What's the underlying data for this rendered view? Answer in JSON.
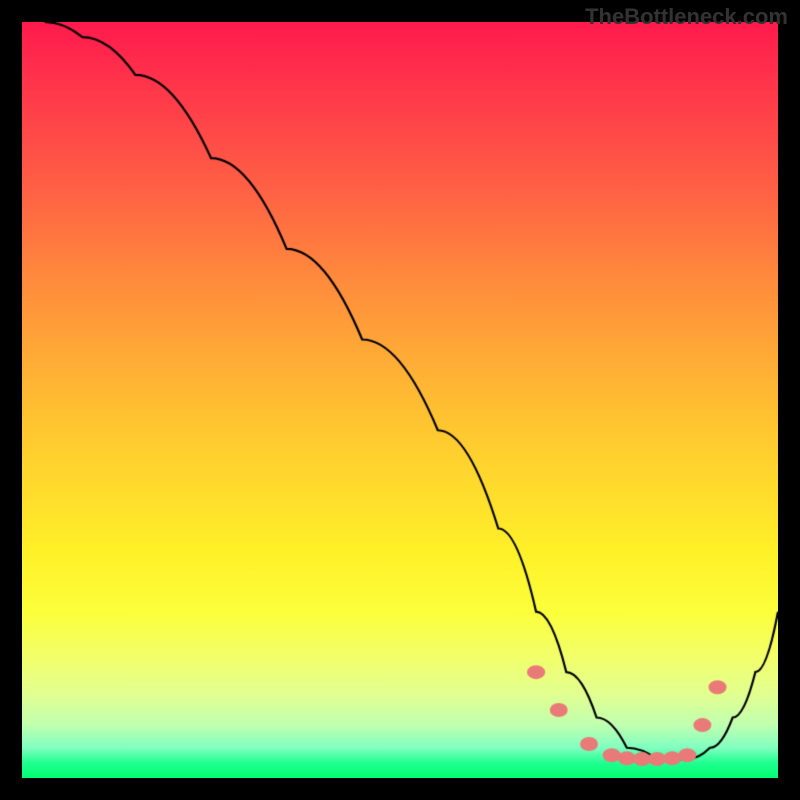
{
  "watermark": "TheBottleneck.com",
  "chart_data": {
    "type": "line",
    "title": "",
    "xlabel": "",
    "ylabel": "",
    "xlim": [
      0,
      100
    ],
    "ylim": [
      0,
      100
    ],
    "series": [
      {
        "name": "main-curve",
        "x": [
          3,
          8,
          15,
          25,
          35,
          45,
          55,
          63,
          68,
          72,
          76,
          80,
          84,
          88,
          91,
          94,
          97,
          100
        ],
        "y": [
          100,
          98,
          93,
          82,
          70,
          58,
          46,
          33,
          22,
          14,
          8,
          4,
          2.5,
          2.5,
          4,
          8,
          14,
          22
        ]
      }
    ],
    "dots": {
      "name": "highlight-dots",
      "color": "#e97a78",
      "x": [
        68,
        71,
        75,
        78,
        80,
        82,
        84,
        86,
        88,
        90,
        92
      ],
      "y": [
        14,
        9,
        4.5,
        3,
        2.6,
        2.5,
        2.5,
        2.6,
        3,
        7,
        12
      ]
    }
  }
}
